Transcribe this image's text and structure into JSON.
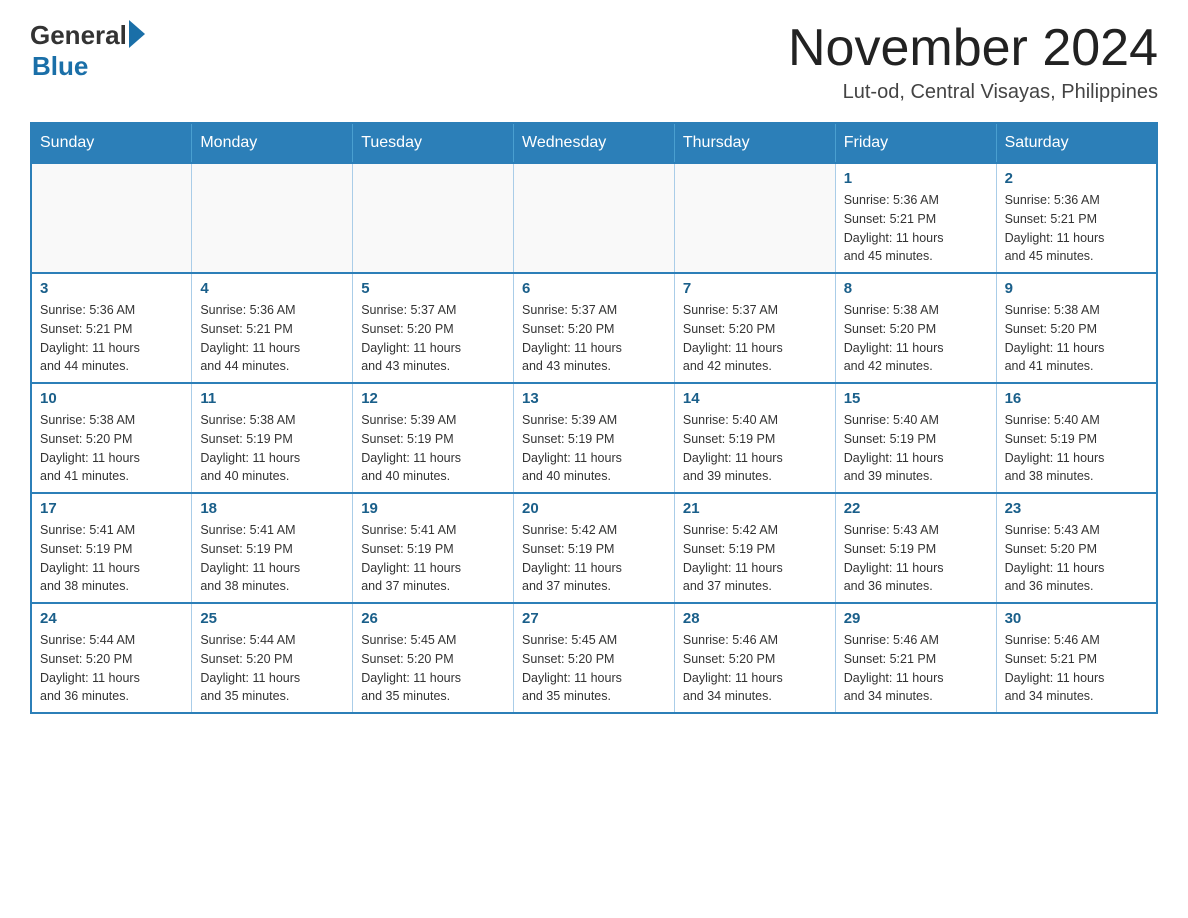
{
  "header": {
    "logo_general": "General",
    "logo_blue": "Blue",
    "main_title": "November 2024",
    "subtitle": "Lut-od, Central Visayas, Philippines"
  },
  "calendar": {
    "days_of_week": [
      "Sunday",
      "Monday",
      "Tuesday",
      "Wednesday",
      "Thursday",
      "Friday",
      "Saturday"
    ],
    "weeks": [
      [
        {
          "day": "",
          "info": ""
        },
        {
          "day": "",
          "info": ""
        },
        {
          "day": "",
          "info": ""
        },
        {
          "day": "",
          "info": ""
        },
        {
          "day": "",
          "info": ""
        },
        {
          "day": "1",
          "info": "Sunrise: 5:36 AM\nSunset: 5:21 PM\nDaylight: 11 hours\nand 45 minutes."
        },
        {
          "day": "2",
          "info": "Sunrise: 5:36 AM\nSunset: 5:21 PM\nDaylight: 11 hours\nand 45 minutes."
        }
      ],
      [
        {
          "day": "3",
          "info": "Sunrise: 5:36 AM\nSunset: 5:21 PM\nDaylight: 11 hours\nand 44 minutes."
        },
        {
          "day": "4",
          "info": "Sunrise: 5:36 AM\nSunset: 5:21 PM\nDaylight: 11 hours\nand 44 minutes."
        },
        {
          "day": "5",
          "info": "Sunrise: 5:37 AM\nSunset: 5:20 PM\nDaylight: 11 hours\nand 43 minutes."
        },
        {
          "day": "6",
          "info": "Sunrise: 5:37 AM\nSunset: 5:20 PM\nDaylight: 11 hours\nand 43 minutes."
        },
        {
          "day": "7",
          "info": "Sunrise: 5:37 AM\nSunset: 5:20 PM\nDaylight: 11 hours\nand 42 minutes."
        },
        {
          "day": "8",
          "info": "Sunrise: 5:38 AM\nSunset: 5:20 PM\nDaylight: 11 hours\nand 42 minutes."
        },
        {
          "day": "9",
          "info": "Sunrise: 5:38 AM\nSunset: 5:20 PM\nDaylight: 11 hours\nand 41 minutes."
        }
      ],
      [
        {
          "day": "10",
          "info": "Sunrise: 5:38 AM\nSunset: 5:20 PM\nDaylight: 11 hours\nand 41 minutes."
        },
        {
          "day": "11",
          "info": "Sunrise: 5:38 AM\nSunset: 5:19 PM\nDaylight: 11 hours\nand 40 minutes."
        },
        {
          "day": "12",
          "info": "Sunrise: 5:39 AM\nSunset: 5:19 PM\nDaylight: 11 hours\nand 40 minutes."
        },
        {
          "day": "13",
          "info": "Sunrise: 5:39 AM\nSunset: 5:19 PM\nDaylight: 11 hours\nand 40 minutes."
        },
        {
          "day": "14",
          "info": "Sunrise: 5:40 AM\nSunset: 5:19 PM\nDaylight: 11 hours\nand 39 minutes."
        },
        {
          "day": "15",
          "info": "Sunrise: 5:40 AM\nSunset: 5:19 PM\nDaylight: 11 hours\nand 39 minutes."
        },
        {
          "day": "16",
          "info": "Sunrise: 5:40 AM\nSunset: 5:19 PM\nDaylight: 11 hours\nand 38 minutes."
        }
      ],
      [
        {
          "day": "17",
          "info": "Sunrise: 5:41 AM\nSunset: 5:19 PM\nDaylight: 11 hours\nand 38 minutes."
        },
        {
          "day": "18",
          "info": "Sunrise: 5:41 AM\nSunset: 5:19 PM\nDaylight: 11 hours\nand 38 minutes."
        },
        {
          "day": "19",
          "info": "Sunrise: 5:41 AM\nSunset: 5:19 PM\nDaylight: 11 hours\nand 37 minutes."
        },
        {
          "day": "20",
          "info": "Sunrise: 5:42 AM\nSunset: 5:19 PM\nDaylight: 11 hours\nand 37 minutes."
        },
        {
          "day": "21",
          "info": "Sunrise: 5:42 AM\nSunset: 5:19 PM\nDaylight: 11 hours\nand 37 minutes."
        },
        {
          "day": "22",
          "info": "Sunrise: 5:43 AM\nSunset: 5:19 PM\nDaylight: 11 hours\nand 36 minutes."
        },
        {
          "day": "23",
          "info": "Sunrise: 5:43 AM\nSunset: 5:20 PM\nDaylight: 11 hours\nand 36 minutes."
        }
      ],
      [
        {
          "day": "24",
          "info": "Sunrise: 5:44 AM\nSunset: 5:20 PM\nDaylight: 11 hours\nand 36 minutes."
        },
        {
          "day": "25",
          "info": "Sunrise: 5:44 AM\nSunset: 5:20 PM\nDaylight: 11 hours\nand 35 minutes."
        },
        {
          "day": "26",
          "info": "Sunrise: 5:45 AM\nSunset: 5:20 PM\nDaylight: 11 hours\nand 35 minutes."
        },
        {
          "day": "27",
          "info": "Sunrise: 5:45 AM\nSunset: 5:20 PM\nDaylight: 11 hours\nand 35 minutes."
        },
        {
          "day": "28",
          "info": "Sunrise: 5:46 AM\nSunset: 5:20 PM\nDaylight: 11 hours\nand 34 minutes."
        },
        {
          "day": "29",
          "info": "Sunrise: 5:46 AM\nSunset: 5:21 PM\nDaylight: 11 hours\nand 34 minutes."
        },
        {
          "day": "30",
          "info": "Sunrise: 5:46 AM\nSunset: 5:21 PM\nDaylight: 11 hours\nand 34 minutes."
        }
      ]
    ]
  }
}
